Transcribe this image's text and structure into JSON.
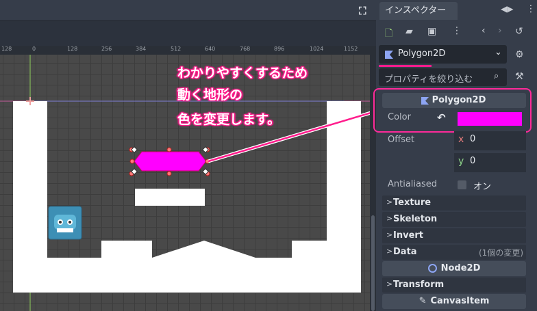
{
  "inspector": {
    "tab_label": "インスペクター",
    "node_name": "Polygon2D",
    "filter_placeholder": "プロパティを絞り込む",
    "section_polygon2d": "Polygon2D",
    "color_label": "Color",
    "color_value": "#ff00ff",
    "offset_label": "Offset",
    "offset_x_label": "x",
    "offset_x_value": "0",
    "offset_y_label": "y",
    "offset_y_value": "0",
    "antialiased_label": "Antialiased",
    "antialiased_value": "オン",
    "folds": [
      {
        "label": "Texture"
      },
      {
        "label": "Skeleton"
      },
      {
        "label": "Invert"
      },
      {
        "label": "Data",
        "note": "(1個の変更)"
      }
    ],
    "section_node2d": "Node2D",
    "transform_label": "Transform",
    "section_canvasitem": "CanvasItem"
  },
  "ruler": {
    "labels": [
      "128",
      "0",
      "128",
      "256",
      "384",
      "512",
      "640",
      "768",
      "896",
      "1024",
      "1152"
    ]
  },
  "annotation": {
    "line1": "わかりやすくするため",
    "line2": "動く地形の",
    "line3": "色を変更します。"
  },
  "colors": {
    "accent": "#ff1c8c",
    "polygon_fill": "#ff00ff",
    "viewport_bg": "#494949",
    "inspector_bg": "#363d4a"
  }
}
